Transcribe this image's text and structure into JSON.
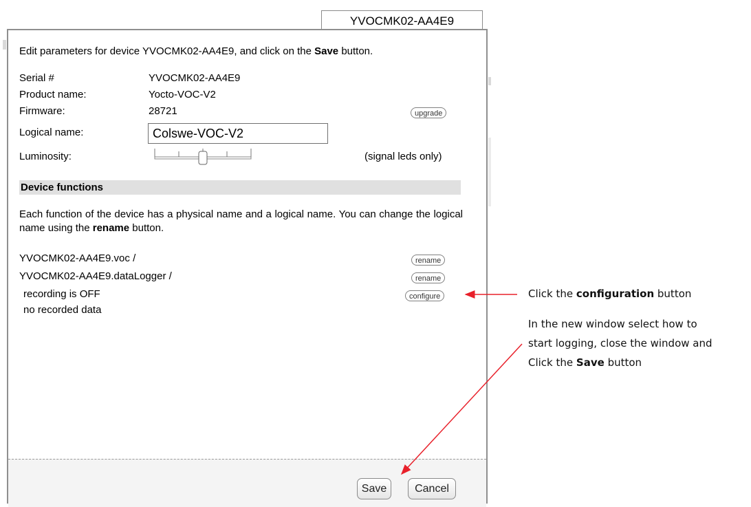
{
  "tab": {
    "title": "YVOCMK02-AA4E9"
  },
  "dialog": {
    "intro_prefix": "Edit parameters for device YVOCMK02-AA4E9, and click on the ",
    "intro_bold": "Save",
    "intro_suffix": " button.",
    "fields": {
      "serial_label": "Serial #",
      "serial_value": "YVOCMK02-AA4E9",
      "product_label": "Product name:",
      "product_value": "Yocto-VOC-V2",
      "firmware_label": "Firmware:",
      "firmware_value": "28721",
      "upgrade_label": "upgrade",
      "logical_label": "Logical name:",
      "logical_value": "Colswe-VOC-V2",
      "luminosity_label": "Luminosity:",
      "luminosity_note": "(signal leds only)",
      "luminosity_level": 0.5
    },
    "functions": {
      "heading": "Device functions",
      "desc_prefix": "Each function of the device has a physical name and a logical name. You can change the logical name using the ",
      "desc_bold": "rename",
      "desc_suffix": " button.",
      "items": [
        {
          "name": "YVOCMK02-AA4E9.voc /",
          "action": "rename"
        },
        {
          "name": "YVOCMK02-AA4E9.dataLogger /",
          "action": "rename"
        }
      ],
      "recording_status": "recording is OFF",
      "configure_label": "configure",
      "recorded_data": "no recorded data"
    },
    "footer": {
      "save_label": "Save",
      "cancel_label": "Cancel"
    }
  },
  "annotations": {
    "note1_prefix": "Click the ",
    "note1_bold": "configuration",
    "note1_suffix": " button",
    "note2_line1": "In the new window select how to",
    "note2_line2": "start logging, close the window and",
    "note2_prefix": "Click the ",
    "note2_bold": "Save",
    "note2_suffix": " button",
    "arrow_color": "#e8202a"
  }
}
